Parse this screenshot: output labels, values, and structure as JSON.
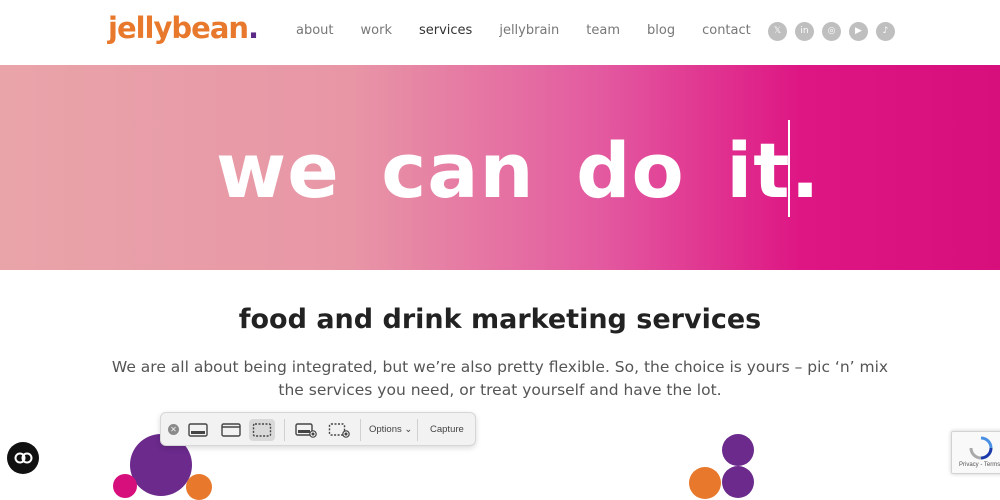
{
  "header": {
    "logo_text": "jellybean",
    "logo_dot": ".",
    "nav": [
      {
        "label": "about"
      },
      {
        "label": "work"
      },
      {
        "label": "services",
        "active": true
      },
      {
        "label": "jellybrain"
      },
      {
        "label": "team"
      },
      {
        "label": "blog"
      },
      {
        "label": "contact"
      }
    ],
    "social": [
      {
        "icon": "x-icon",
        "glyph": "𝕏"
      },
      {
        "icon": "linkedin-icon",
        "glyph": "in"
      },
      {
        "icon": "instagram-icon",
        "glyph": "◎"
      },
      {
        "icon": "youtube-icon",
        "glyph": "▶"
      },
      {
        "icon": "tiktok-icon",
        "glyph": "♪"
      }
    ]
  },
  "hero": {
    "headline": "we can do it."
  },
  "services": {
    "title": "food and drink marketing services",
    "body": "We are all about being integrated, but we’re also pretty flexible. So, the choice is yours – pic ‘n’ mix the services you need, or treat yourself and have the lot."
  },
  "screenshot_toolbar": {
    "options_label": "Options",
    "capture_label": "Capture"
  },
  "colors": {
    "brand_orange": "#e8782b",
    "brand_purple": "#5b2a86",
    "hero_pink": "#d70f7c"
  }
}
